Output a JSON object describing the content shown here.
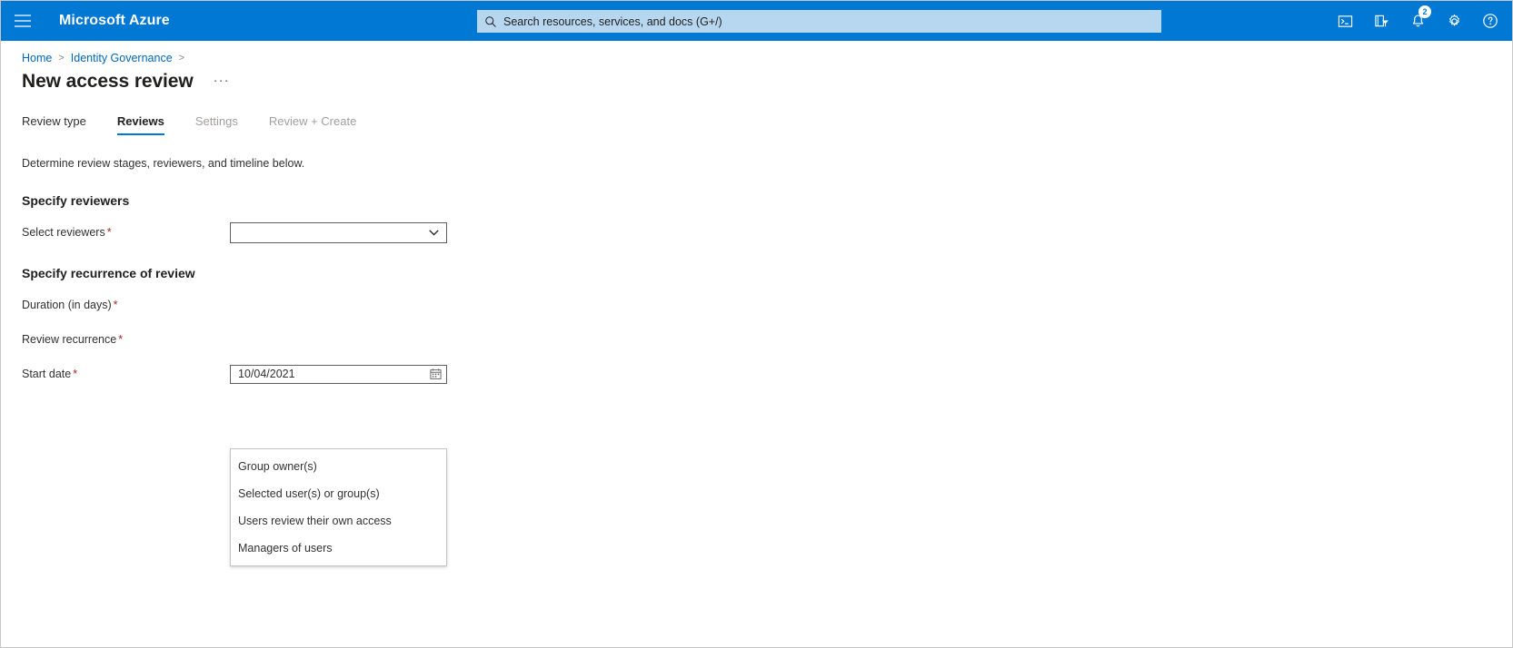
{
  "topbar": {
    "menu_icon": "hamburger-icon",
    "brand": "Microsoft Azure",
    "search": {
      "icon": "search-icon",
      "placeholder": "Search resources, services, and docs (G+/)",
      "value": ""
    },
    "icons": [
      {
        "name": "cloud-shell-icon",
        "label": "Cloud Shell"
      },
      {
        "name": "directories-subscriptions-icon",
        "label": "Directories + subscriptions"
      },
      {
        "name": "notifications-bell-icon",
        "label": "Notifications",
        "badge": "2"
      },
      {
        "name": "settings-gear-icon",
        "label": "Settings"
      },
      {
        "name": "help-question-icon",
        "label": "Help"
      }
    ],
    "accent_color": "#0078d4",
    "search_bg": "#b7d7f0"
  },
  "breadcrumb": {
    "items": [
      {
        "label": "Home",
        "link": true
      },
      {
        "label": "Identity Governance",
        "link": true
      }
    ],
    "separator": ">",
    "trailing_separator": ">"
  },
  "header": {
    "title": "New access review",
    "more_menu": "···"
  },
  "tabs": [
    {
      "label": "Review type",
      "state": "enabled"
    },
    {
      "label": "Reviews",
      "state": "active"
    },
    {
      "label": "Settings",
      "state": "disabled"
    },
    {
      "label": "Review + Create",
      "state": "disabled"
    }
  ],
  "main": {
    "subtitle": "Determine review stages, reviewers, and timeline below.",
    "sections": [
      {
        "heading": "Specify reviewers",
        "fields": [
          {
            "label": "Select reviewers",
            "required_mark": "*",
            "control": "select",
            "value": "",
            "chevron": "chevron-down-icon"
          }
        ]
      },
      {
        "heading": "Specify recurrence of review",
        "fields": [
          {
            "label": "Duration (in days)",
            "required_mark": "*",
            "control": "none",
            "value": ""
          },
          {
            "label": "Review recurrence",
            "required_mark": "*",
            "control": "none",
            "value": ""
          },
          {
            "label": "Start date",
            "required_mark": "*",
            "control": "date",
            "value": "10/04/2021",
            "icon": "calendar-icon"
          }
        ]
      }
    ]
  },
  "dropdown": {
    "open": true,
    "options": [
      "Group owner(s)",
      "Selected user(s) or group(s)",
      "Users review their own access",
      "Managers of users"
    ]
  },
  "colors": {
    "azure_blue": "#0078d4",
    "link_blue": "#0067b8",
    "required_red": "#a4262c",
    "text": "#323130",
    "disabled_text": "#a19f9d"
  }
}
